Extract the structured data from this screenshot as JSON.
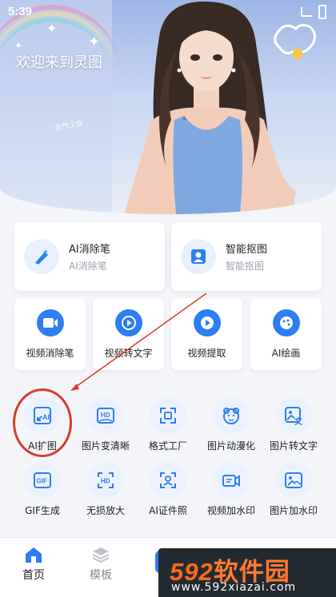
{
  "status": {
    "time": "5:39"
  },
  "hero": {
    "welcome": "欢迎来到灵图",
    "tag": "元气少女"
  },
  "tools_big": [
    {
      "title": "AI消除笔",
      "sub": "AI消除笔",
      "icon": "magic-eraser-icon"
    },
    {
      "title": "智能抠图",
      "sub": "智能抠图",
      "icon": "cutout-icon"
    }
  ],
  "tools_mid": [
    {
      "label": "视频消除笔",
      "icon": "video-eraser-icon"
    },
    {
      "label": "视频转文字",
      "icon": "video-to-text-icon"
    },
    {
      "label": "视频提取",
      "icon": "video-extract-icon"
    },
    {
      "label": "AI绘画",
      "icon": "ai-painting-icon"
    }
  ],
  "grid_row1": [
    {
      "label": "AI扩图",
      "icon": "ai-expand-icon"
    },
    {
      "label": "图片变清晰",
      "icon": "hd-image-icon"
    },
    {
      "label": "格式工厂",
      "icon": "format-factory-icon"
    },
    {
      "label": "图片动漫化",
      "icon": "anime-bear-icon"
    },
    {
      "label": "图片转文字",
      "icon": "image-to-text-icon"
    }
  ],
  "grid_row2": [
    {
      "label": "GIF生成",
      "icon": "gif-icon"
    },
    {
      "label": "无损放大",
      "icon": "hd-upscale-icon"
    },
    {
      "label": "AI证件照",
      "icon": "id-photo-icon"
    },
    {
      "label": "视频加水印",
      "icon": "video-watermark-icon"
    },
    {
      "label": "图片加水印",
      "icon": "image-watermark-icon"
    }
  ],
  "nav": {
    "home": "首页",
    "templates": "模板"
  },
  "watermark": {
    "brand_num": "592",
    "brand_cn": "软件园",
    "url": "www.592xiazai.com"
  },
  "colors": {
    "accent": "#2d7df3",
    "highlight": "#d93b2b"
  }
}
